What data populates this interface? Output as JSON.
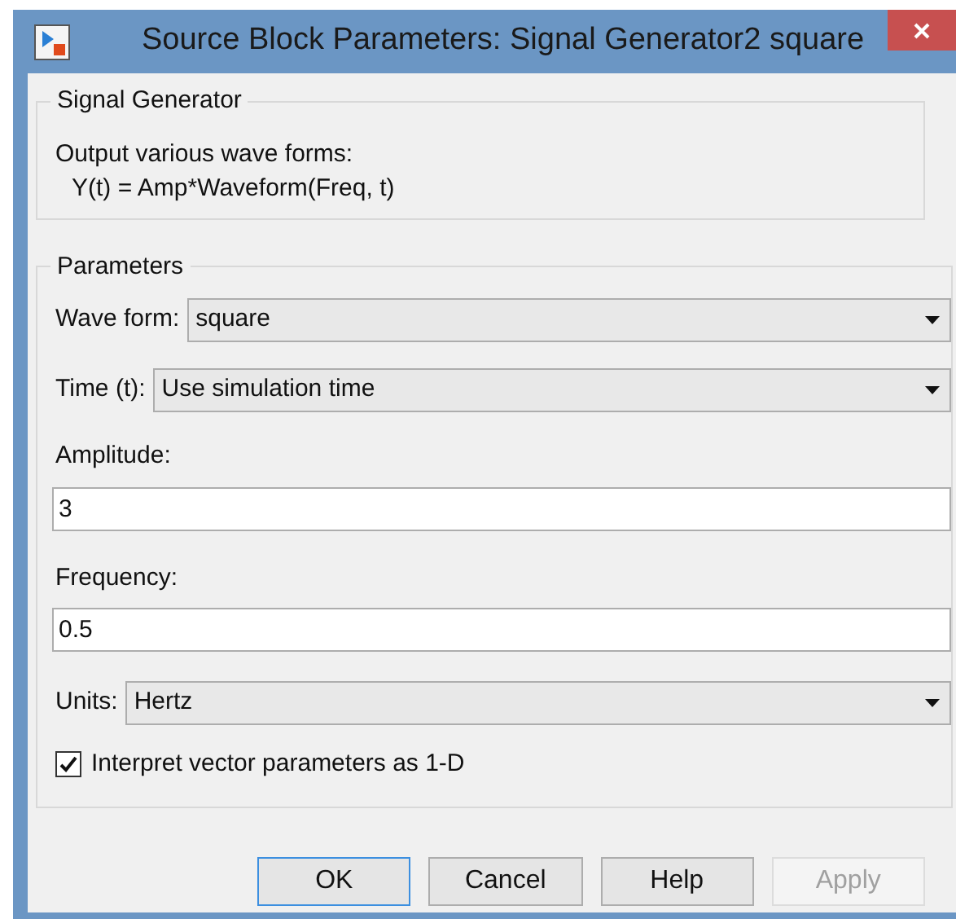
{
  "window": {
    "title": "Source Block Parameters: Signal Generator2 square"
  },
  "block": {
    "title": "Signal Generator",
    "description": [
      "Output various wave forms:",
      "Y(t) = Amp*Waveform(Freq, t)"
    ]
  },
  "parameters": {
    "title": "Parameters",
    "fields": [
      {
        "kind": "select",
        "label": "Wave form:",
        "value": "square"
      },
      {
        "kind": "select",
        "label": "Time (t):",
        "value": "Use simulation time"
      },
      {
        "kind": "text",
        "label": "Amplitude:",
        "value": "3"
      },
      {
        "kind": "text",
        "label": "Frequency:",
        "value": "0.5"
      },
      {
        "kind": "select",
        "label": "Units:",
        "value": "Hertz"
      },
      {
        "kind": "checkbox",
        "label": "Interpret vector parameters as 1-D",
        "checked": true
      }
    ]
  },
  "buttons": [
    {
      "label": "OK",
      "disabled": false,
      "selected": true
    },
    {
      "label": "Cancel",
      "disabled": false,
      "selected": false
    },
    {
      "label": "Help",
      "disabled": false,
      "selected": false
    },
    {
      "label": "Apply",
      "disabled": true,
      "selected": false
    }
  ]
}
